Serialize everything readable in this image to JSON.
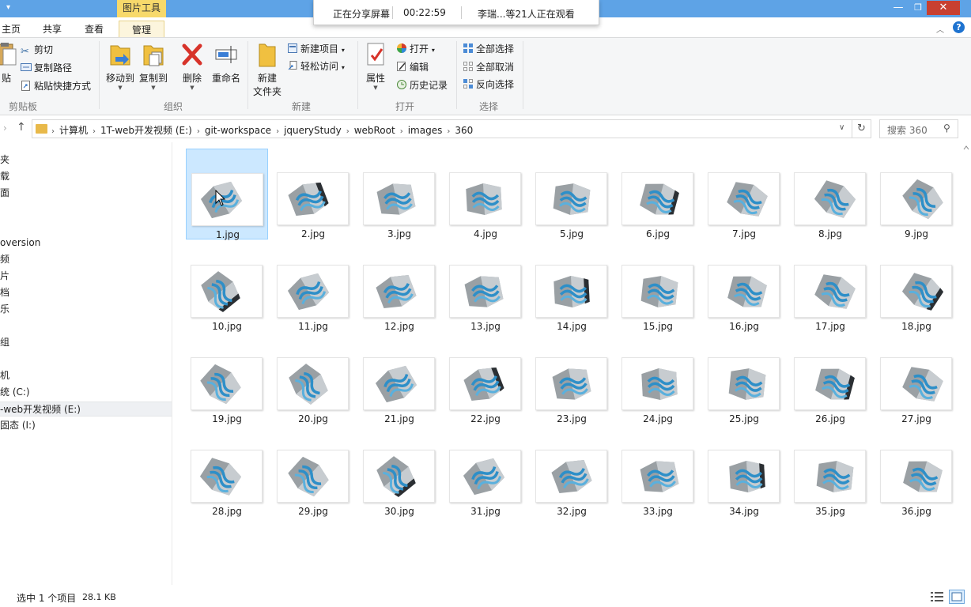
{
  "window": {
    "context_tab_group": "图片工具",
    "minimize_glyph": "—",
    "maximize_glyph": "❐",
    "close_glyph": "✕"
  },
  "share_banner": {
    "label": "正在分享屏幕",
    "elapsed": "00:22:59",
    "watchers": "李瑞...等21人正在观看"
  },
  "ribbon_tabs": {
    "home": "主页",
    "share": "共享",
    "view": "查看",
    "manage": "管理"
  },
  "ribbon": {
    "clipboard": {
      "paste_partial": "贴",
      "cut": "剪切",
      "copy_path": "复制路径",
      "paste_shortcut": "粘贴快捷方式",
      "group_label": "剪贴板"
    },
    "organize": {
      "move_to": "移动到",
      "copy_to": "复制到",
      "delete": "删除",
      "rename": "重命名",
      "group_label": "组织"
    },
    "new": {
      "new_folder_line1": "新建",
      "new_folder_line2": "文件夹",
      "new_item": "新建项目",
      "easy_access": "轻松访问",
      "group_label": "新建"
    },
    "open": {
      "properties": "属性",
      "open": "打开",
      "edit": "编辑",
      "history": "历史记录",
      "group_label": "打开"
    },
    "select": {
      "select_all": "全部选择",
      "select_none": "全部取消",
      "invert": "反向选择",
      "group_label": "选择"
    }
  },
  "address": {
    "crumbs": [
      "计算机",
      "1T-web开发视频 (E:)",
      "git-workspace",
      "jqueryStudy",
      "webRoot",
      "images",
      "360"
    ],
    "search_placeholder": "搜索 360"
  },
  "nav_pane": {
    "items": [
      "夹",
      "载",
      "面",
      "oversion",
      "频",
      "片",
      "档",
      "乐",
      "组",
      "机",
      "统 (C:)",
      "-web开发视频 (E:)",
      "固态 (I:)"
    ]
  },
  "files": [
    {
      "name": "1.jpg",
      "selected": true
    },
    {
      "name": "2.jpg"
    },
    {
      "name": "3.jpg"
    },
    {
      "name": "4.jpg"
    },
    {
      "name": "5.jpg"
    },
    {
      "name": "6.jpg"
    },
    {
      "name": "7.jpg"
    },
    {
      "name": "8.jpg"
    },
    {
      "name": "9.jpg"
    },
    {
      "name": "10.jpg"
    },
    {
      "name": "11.jpg"
    },
    {
      "name": "12.jpg"
    },
    {
      "name": "13.jpg"
    },
    {
      "name": "14.jpg"
    },
    {
      "name": "15.jpg"
    },
    {
      "name": "16.jpg"
    },
    {
      "name": "17.jpg"
    },
    {
      "name": "18.jpg"
    },
    {
      "name": "19.jpg"
    },
    {
      "name": "20.jpg"
    },
    {
      "name": "21.jpg"
    },
    {
      "name": "22.jpg"
    },
    {
      "name": "23.jpg"
    },
    {
      "name": "24.jpg"
    },
    {
      "name": "25.jpg"
    },
    {
      "name": "26.jpg"
    },
    {
      "name": "27.jpg"
    },
    {
      "name": "28.jpg"
    },
    {
      "name": "29.jpg"
    },
    {
      "name": "30.jpg"
    },
    {
      "name": "31.jpg"
    },
    {
      "name": "32.jpg"
    },
    {
      "name": "33.jpg"
    },
    {
      "name": "34.jpg"
    },
    {
      "name": "35.jpg"
    },
    {
      "name": "36.jpg"
    }
  ],
  "status": {
    "selection": "选中 1 个项目",
    "size": "28.1 KB"
  },
  "colors": {
    "titlebar": "#5ea3e6",
    "selection_fill": "#cce8ff",
    "cube_blue": "#2e8fc8",
    "cube_grey": "#9aa0a4",
    "cube_dark": "#2b2f33"
  }
}
